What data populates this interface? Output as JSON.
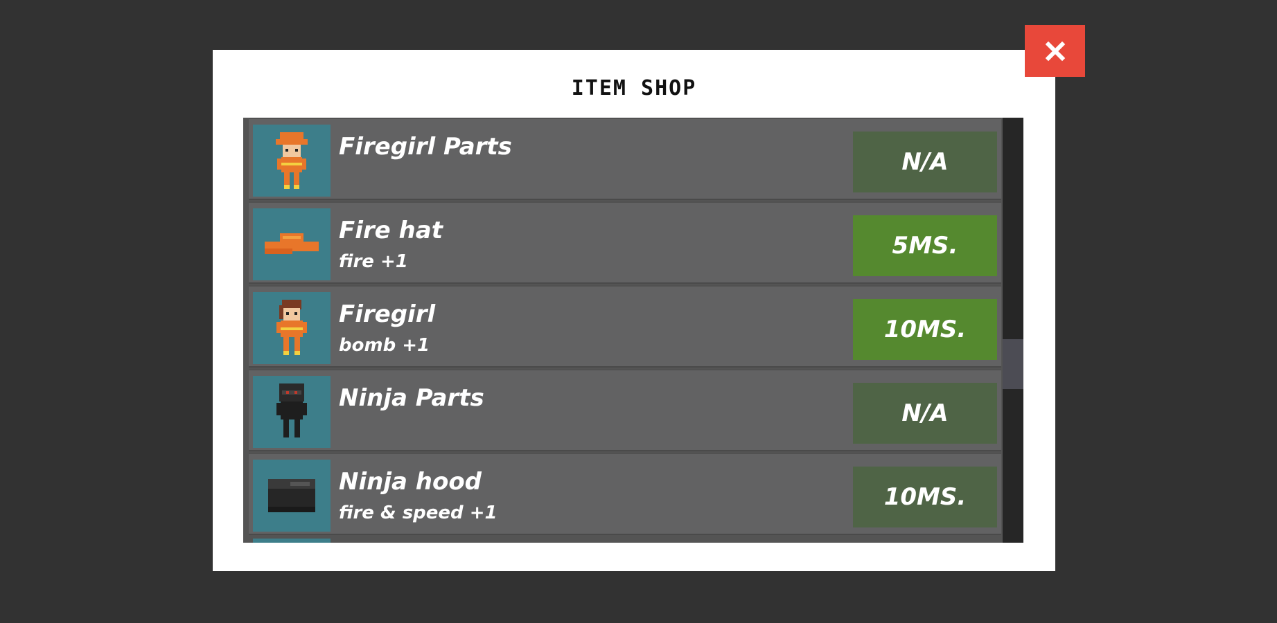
{
  "shop": {
    "title": "ITEM SHOP",
    "close_icon": "close-icon",
    "items": [
      {
        "name": "Firegirl Parts",
        "desc": "",
        "price": "N/A",
        "state": "disabled",
        "icon": "firegirl-sprite-icon"
      },
      {
        "name": "Fire hat",
        "desc": "fire +1",
        "price": "5MS.",
        "state": "active",
        "icon": "fire-hat-icon"
      },
      {
        "name": "Firegirl",
        "desc": "bomb +1",
        "price": "10MS.",
        "state": "active",
        "icon": "firegirl-character-icon"
      },
      {
        "name": "Ninja Parts",
        "desc": "",
        "price": "N/A",
        "state": "disabled",
        "icon": "ninja-sprite-icon"
      },
      {
        "name": "Ninja hood",
        "desc": "fire & speed +1",
        "price": "10MS.",
        "state": "disabled",
        "icon": "ninja-hood-icon"
      }
    ]
  },
  "colors": {
    "background": "#323232",
    "modal": "#ffffff",
    "close_button": "#e8483a",
    "row": "#626263",
    "thumb": "#3d7e8a",
    "price_active": "#55892f",
    "price_disabled": "#4f6446",
    "scrollbar": "#262626"
  }
}
